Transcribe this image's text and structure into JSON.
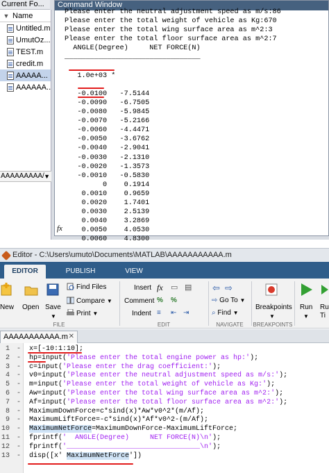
{
  "current_folder": {
    "header": "Current Fo...",
    "column_name": "Name",
    "sort_arrow": "▼",
    "files": [
      {
        "name": "Untitled.m",
        "selected": false
      },
      {
        "name": "UmutOz...",
        "selected": false
      },
      {
        "name": "TEST.m",
        "selected": false
      },
      {
        "name": "credit.m",
        "selected": false
      },
      {
        "name": "AAAAA...",
        "selected": true
      },
      {
        "name": "AAAAAA...",
        "selected": false
      }
    ],
    "path_field": "AAAAAAAAA/",
    "path_dropdown": "▼"
  },
  "command_window": {
    "title": "Command Window",
    "lines": [
      "Please enter the neutral adjustment speed as m/s:86",
      "Please enter the total weight of vehicle as Kg:670",
      "Please enter the total wing surface area as m^2:3",
      "Please enter the total floor surface area as m^2:7",
      "  ANGLE(Degree)     NET FORCE(N)",
      "________________________________",
      "",
      "   1.0e+03 *",
      "",
      "   -0.0100   -7.5144",
      "   -0.0090   -6.7505",
      "   -0.0080   -5.9845",
      "   -0.0070   -5.2166",
      "   -0.0060   -4.4471",
      "   -0.0050   -3.6762",
      "   -0.0040   -2.9041",
      "   -0.0030   -2.1310",
      "   -0.0020   -1.3573",
      "   -0.0010   -0.5830",
      "         0    0.1914",
      "    0.0010    0.9659",
      "    0.0020    1.7401",
      "    0.0030    2.5139",
      "    0.0040    3.2869",
      "    0.0050    4.0530",
      "    0.0060    4.8300"
    ],
    "prompt": "fx"
  },
  "editor": {
    "title": "Editor - C:\\Users\\umuto\\Documents\\MATLAB\\AAAAAAAAAAA.m",
    "tabs": [
      "EDITOR",
      "PUBLISH",
      "VIEW"
    ],
    "ribbon": {
      "new": "New",
      "open": "Open",
      "save": "Save",
      "find_files": "Find Files",
      "compare": "Compare",
      "print": "Print",
      "insert": "Insert",
      "comment": "Comment",
      "indent": "Indent",
      "fx": "fx",
      "percent": "%",
      "goto": "Go To",
      "find": "Find",
      "breakpoints": "Breakpoints",
      "run": "Run",
      "run_adv": "Ru",
      "run_adv2": "Ti",
      "groups": {
        "file": "FILE",
        "edit": "EDIT",
        "navigate": "NAVIGATE",
        "breakpoints": "BREAKPOINTS"
      }
    },
    "document_tab": "AAAAAAAAAAA.m",
    "code_lines": [
      {
        "n": "1",
        "parts": [
          {
            "t": "x=[-10:1:10];",
            "c": ""
          }
        ]
      },
      {
        "n": "2",
        "parts": [
          {
            "t": "hp=input(",
            "c": ""
          },
          {
            "t": "'Please enter the total engine power as hp:'",
            "c": "str"
          },
          {
            "t": ");",
            "c": ""
          }
        ]
      },
      {
        "n": "3",
        "parts": [
          {
            "t": "c=input(",
            "c": ""
          },
          {
            "t": "'Please enter the drag coefficient:'",
            "c": "str"
          },
          {
            "t": ");",
            "c": ""
          }
        ]
      },
      {
        "n": "4",
        "parts": [
          {
            "t": "v0=input(",
            "c": ""
          },
          {
            "t": "'Please enter the neutral adjustment speed as m/s:'",
            "c": "str"
          },
          {
            "t": ");",
            "c": ""
          }
        ]
      },
      {
        "n": "5",
        "parts": [
          {
            "t": "m=input(",
            "c": ""
          },
          {
            "t": "'Please enter the total weight of vehicle as Kg:'",
            "c": "str"
          },
          {
            "t": ");",
            "c": ""
          }
        ]
      },
      {
        "n": "6",
        "parts": [
          {
            "t": "Aw=input(",
            "c": ""
          },
          {
            "t": "'Please enter the total wing surface area as m^2:'",
            "c": "str"
          },
          {
            "t": ");",
            "c": ""
          }
        ]
      },
      {
        "n": "7",
        "parts": [
          {
            "t": "Af=input(",
            "c": ""
          },
          {
            "t": "'Please enter the total floor surface area as m^2:'",
            "c": "str"
          },
          {
            "t": ");",
            "c": ""
          }
        ]
      },
      {
        "n": "8",
        "parts": [
          {
            "t": "MaximumDownForce=c*sind(x)*Aw*v0^2*(m/Af);",
            "c": ""
          }
        ]
      },
      {
        "n": "9",
        "parts": [
          {
            "t": "MaximumLiftForce=-c*sind(x)*Af*v0^2-(m/Af);",
            "c": ""
          }
        ]
      },
      {
        "n": "10",
        "parts": [
          {
            "t": "MaximumNetForce",
            "c": "hl"
          },
          {
            "t": "=MaximumDownForce-MaximumLiftForce;",
            "c": ""
          }
        ]
      },
      {
        "n": "11",
        "parts": [
          {
            "t": "fprintf(",
            "c": ""
          },
          {
            "t": "'  ANGLE(Degree)     NET FORCE(N)\\n'",
            "c": "str"
          },
          {
            "t": ");",
            "c": ""
          }
        ]
      },
      {
        "n": "12",
        "parts": [
          {
            "t": "fprintf(",
            "c": ""
          },
          {
            "t": "'________________________________\\n'",
            "c": "str"
          },
          {
            "t": ");",
            "c": ""
          }
        ]
      },
      {
        "n": "13",
        "parts": [
          {
            "t": "disp([x' ",
            "c": ""
          },
          {
            "t": "MaximumNetForce",
            "c": "hl"
          },
          {
            "t": "'])",
            "c": ""
          }
        ]
      }
    ]
  },
  "colors": {
    "annotation_red": "#e21c1c",
    "string_purple": "#a020f0",
    "tab_bar_blue": "#2f5d8a",
    "window_title_blue": "#46617f"
  }
}
